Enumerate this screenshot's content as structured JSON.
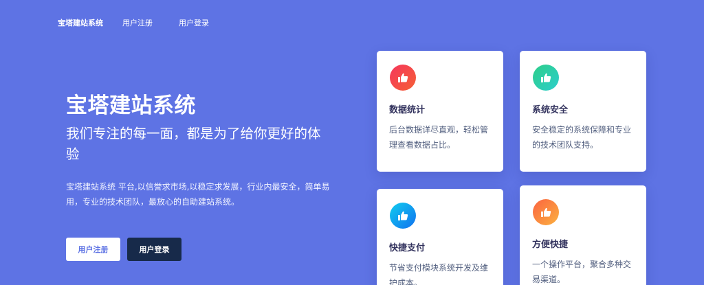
{
  "nav": {
    "brand": "宝塔建站系统",
    "links": [
      "用户注册",
      "用户登录"
    ]
  },
  "hero": {
    "title": "宝塔建站系统",
    "subtitle": "我们专注的每一面，都是为了给你更好的体验",
    "description": "宝塔建站系统 平台,以信誉求市场,以稳定求发展，行业内最安全，简单易用，专业的技术团队，最放心的自助建站系统。",
    "register_label": "用户注册",
    "login_label": "用户登录"
  },
  "features": [
    {
      "title": "数据统计",
      "desc": "后台数据详尽直观，轻松管理查看数据占比。",
      "icon": "thumbs-up-icon",
      "color": "#f5365c"
    },
    {
      "title": "系统安全",
      "desc": "安全稳定的系统保障和专业的技术团队支持。",
      "icon": "thumbs-up-icon",
      "color": "#2dce89"
    },
    {
      "title": "快捷支付",
      "desc": "节省支付模块系统开发及维护成本。",
      "icon": "thumbs-up-icon",
      "color": "#11cdef"
    },
    {
      "title": "方便快捷",
      "desc": "一个操作平台，聚合多种交易渠道。",
      "icon": "thumbs-up-icon",
      "color": "#fb6340"
    }
  ],
  "colors": {
    "background": "#5e73e4",
    "dark_button": "#172a4a",
    "card_text": "#32325d"
  }
}
